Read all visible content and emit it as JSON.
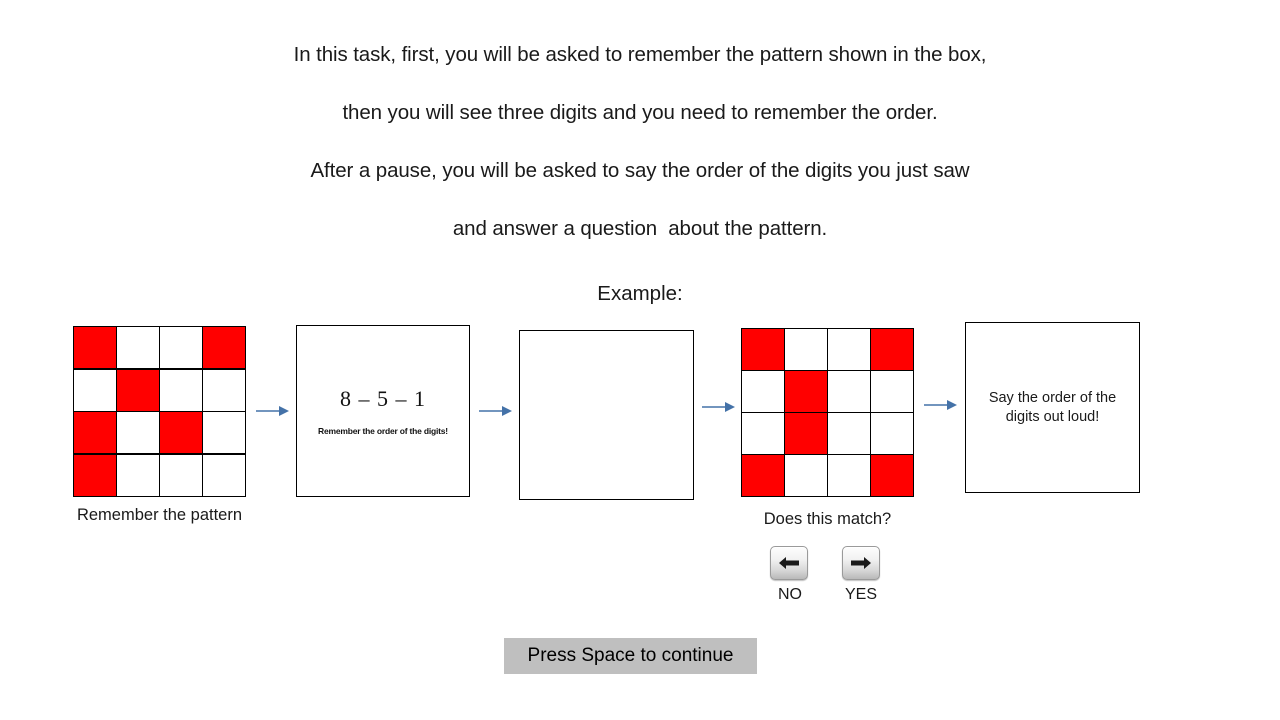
{
  "instructions": {
    "lines": [
      "In this task, first, you will be asked to remember the pattern shown in the box,",
      "then you will see three digits and you need to remember the order.",
      "After a pause, you will be asked to say the order of the digits you just saw",
      "and answer a question  about the pattern."
    ],
    "example_label": "Example:"
  },
  "colors": {
    "cell_on": "#ff0000",
    "cell_off": "#ffffff",
    "arrow": "#4472a8",
    "continue_bar_bg": "#bfbfbf",
    "border": "#000000"
  },
  "stage": {
    "pattern_grid": {
      "caption": "Remember the pattern",
      "rows": [
        [
          1,
          0,
          0,
          1
        ],
        [
          0,
          1,
          0,
          0
        ],
        [
          1,
          0,
          1,
          0
        ],
        [
          1,
          0,
          0,
          0
        ]
      ]
    },
    "digits_box": {
      "digits": "8 – 5 – 1",
      "hint": "Remember the order of the digits!"
    },
    "blank_box": {
      "content": ""
    },
    "probe_grid": {
      "caption": "Does this match?",
      "rows": [
        [
          1,
          0,
          0,
          1
        ],
        [
          0,
          1,
          0,
          0
        ],
        [
          0,
          1,
          0,
          0
        ],
        [
          1,
          0,
          0,
          1
        ]
      ]
    },
    "say_box": {
      "text": "Say the order of the digits out loud!"
    },
    "response_keys": [
      {
        "icon": "arrow-left-icon",
        "label": "NO"
      },
      {
        "icon": "arrow-right-icon",
        "label": "YES"
      }
    ]
  },
  "continue": {
    "label": "Press Space to continue"
  }
}
